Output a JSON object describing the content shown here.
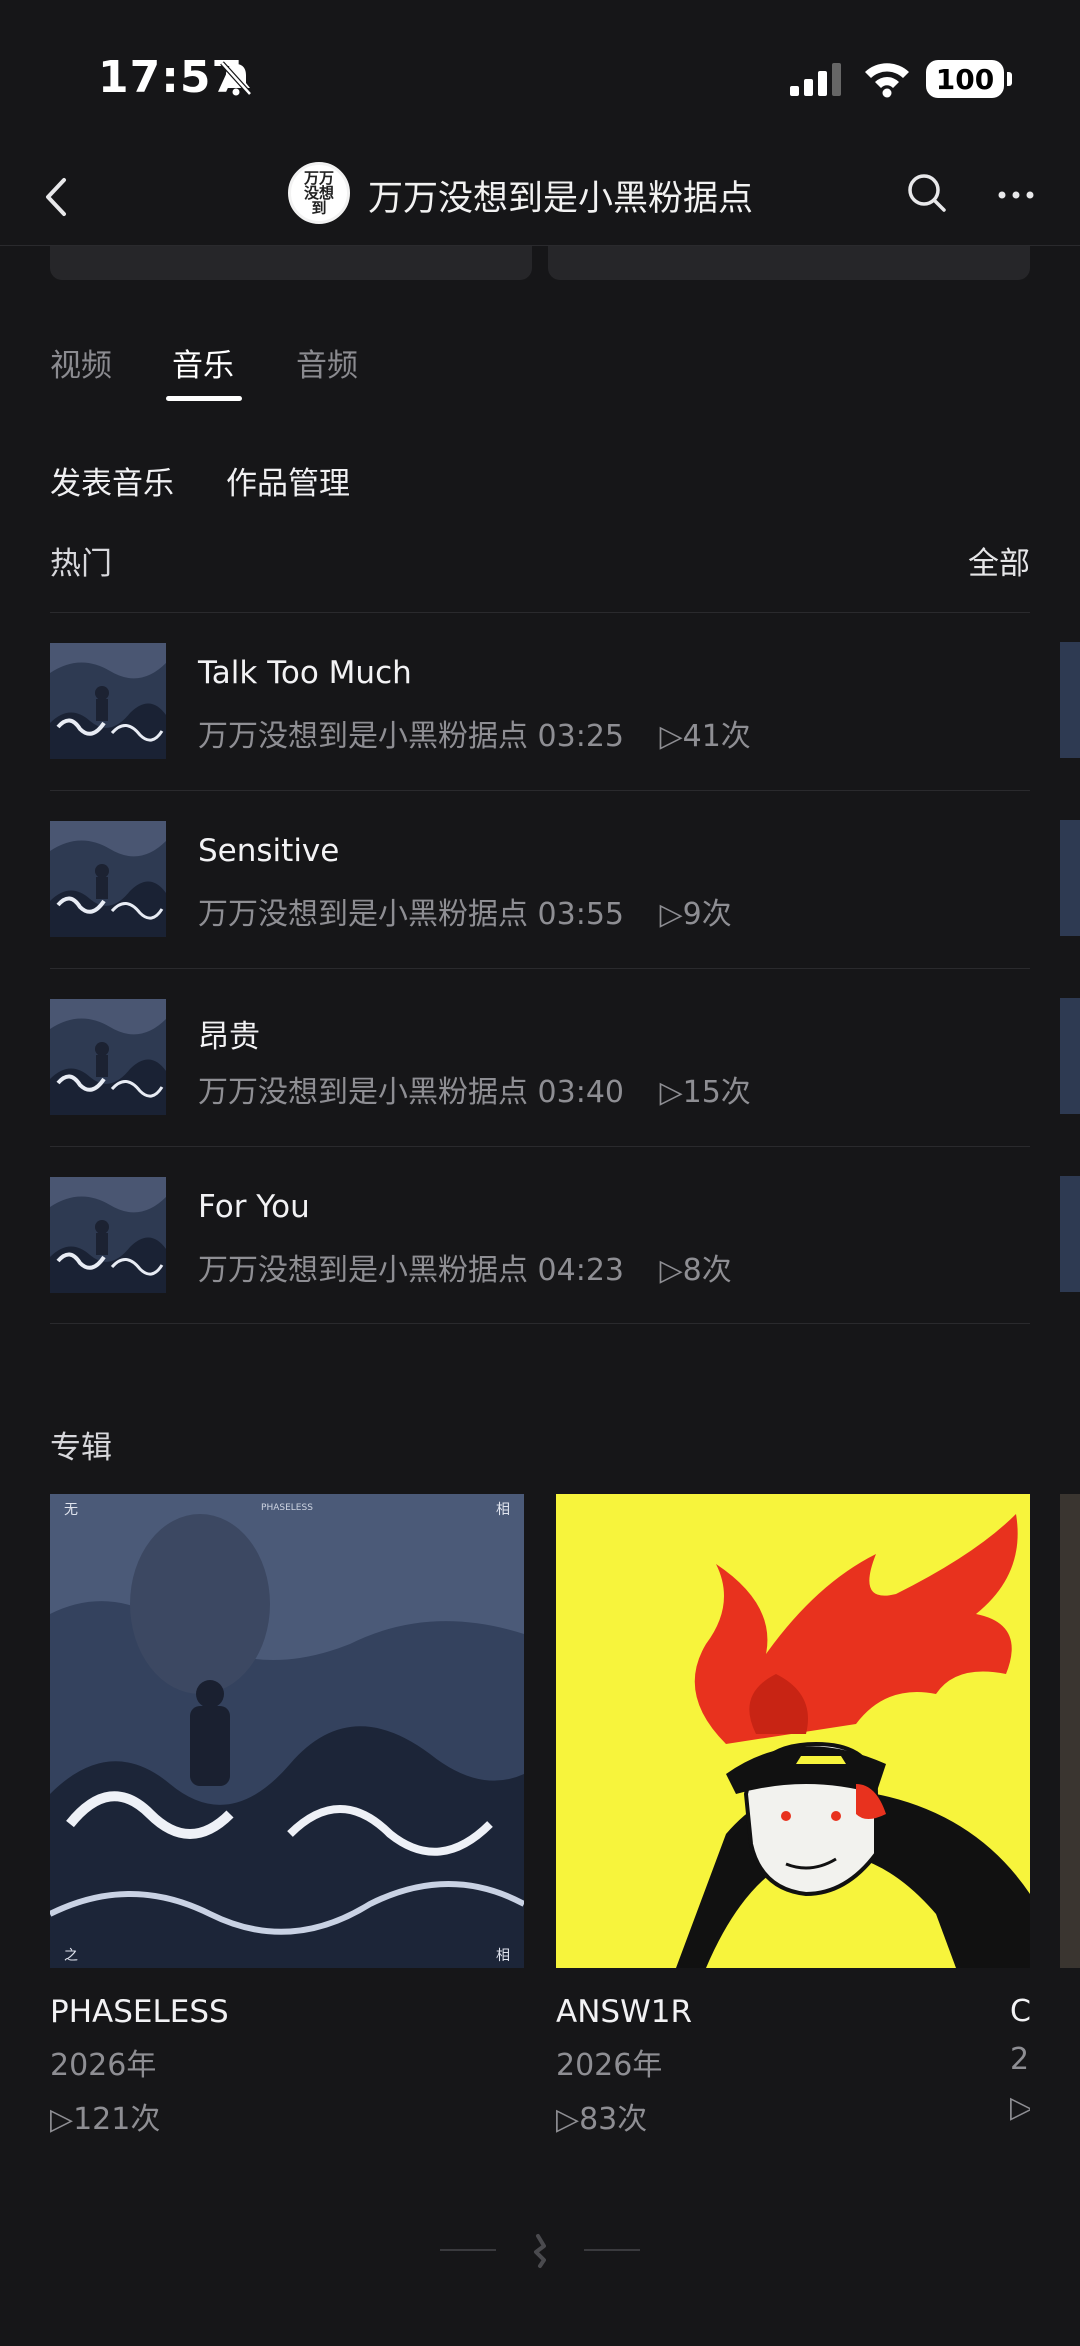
{
  "status": {
    "time": "17:57",
    "battery": "100"
  },
  "nav": {
    "title": "万万没想到是小黑粉据点",
    "avatar_text": "万万没想到"
  },
  "tabs": [
    {
      "label": "视频",
      "active": false
    },
    {
      "label": "音乐",
      "active": true
    },
    {
      "label": "音频",
      "active": false
    }
  ],
  "actions": {
    "publish": "发表音乐",
    "manage": "作品管理"
  },
  "hot": {
    "title": "热门",
    "all": "全部"
  },
  "songs": [
    {
      "title": "Talk Too Much",
      "artist": "万万没想到是小黑粉据点",
      "duration": "03:25",
      "plays": "▷41次"
    },
    {
      "title": "Sensitive",
      "artist": "万万没想到是小黑粉据点",
      "duration": "03:55",
      "plays": "▷9次"
    },
    {
      "title": "昂贵",
      "artist": "万万没想到是小黑粉据点",
      "duration": "03:40",
      "plays": "▷15次"
    },
    {
      "title": "For You",
      "artist": "万万没想到是小黑粉据点",
      "duration": "04:23",
      "plays": "▷8次"
    }
  ],
  "albums_section": {
    "title": "专辑"
  },
  "albums": [
    {
      "name": "PHASELESS",
      "year": "2026年",
      "plays": "▷121次",
      "cover_top": "PHASELESS",
      "cover_chars": [
        "无",
        "相",
        "之",
        "相"
      ]
    },
    {
      "name": "ANSW1R",
      "year": "2026年",
      "plays": "▷83次"
    }
  ],
  "album_edge": {
    "name": "C",
    "year": "2",
    "plays": "▷"
  },
  "colors": {
    "background": "#161618",
    "divider": "#2a2a2d",
    "muted_text": "#8e8e93",
    "album2_bg": "#f7f43c",
    "flame": "#e8321e"
  }
}
